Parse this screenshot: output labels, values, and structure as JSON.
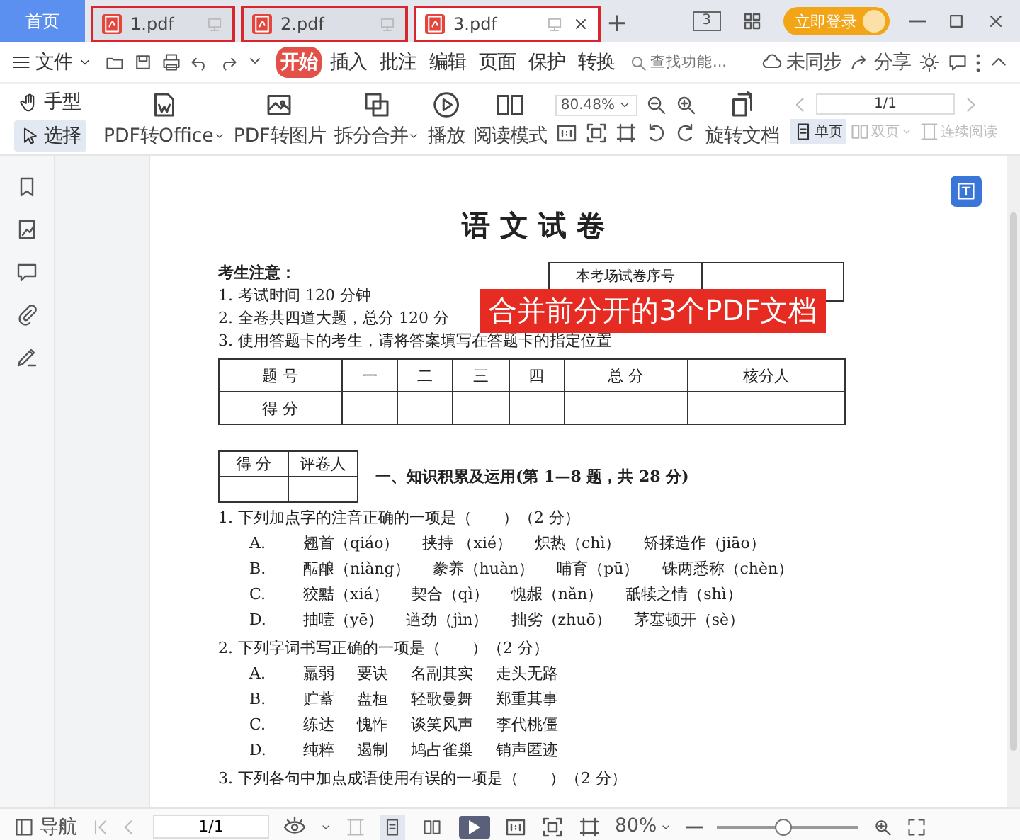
{
  "title_bar": {
    "home_tab": "首页",
    "tabs": [
      {
        "label": "1.pdf",
        "selected": false,
        "annotated": true
      },
      {
        "label": "2.pdf",
        "selected": false,
        "annotated": true
      },
      {
        "label": "3.pdf",
        "selected": true,
        "annotated": true
      }
    ],
    "new_tab": "+",
    "layout_badge": "3",
    "login": "立即登录"
  },
  "menu_bar": {
    "file": "文件",
    "tabs": [
      {
        "label": "开始",
        "selected": true
      },
      {
        "label": "插入",
        "selected": false
      },
      {
        "label": "批注",
        "selected": false
      },
      {
        "label": "编辑",
        "selected": false
      },
      {
        "label": "页面",
        "selected": false
      },
      {
        "label": "保护",
        "selected": false
      },
      {
        "label": "转换",
        "selected": false
      }
    ],
    "search": {
      "placeholder": "查找功能..."
    },
    "sync": "未同步",
    "share": "分享"
  },
  "toolbar": {
    "tools": [
      {
        "label": "手型",
        "kind": "hand",
        "selected": false
      },
      {
        "label": "选择",
        "kind": "select",
        "selected": true
      }
    ],
    "buttons": [
      {
        "label": "PDF转Office",
        "kind": "office",
        "has_menu": true
      },
      {
        "label": "PDF转图片",
        "kind": "image",
        "has_menu": false
      },
      {
        "label": "拆分合并",
        "kind": "split",
        "has_menu": true
      },
      {
        "label": "播放",
        "kind": "play",
        "has_menu": false
      },
      {
        "label": "阅读模式",
        "kind": "read",
        "has_menu": false
      }
    ],
    "zoom": "80.48%",
    "rotate": "旋转文档",
    "page": "1/1",
    "views": [
      {
        "label": "单页",
        "kind": "single",
        "selected": true,
        "disabled": false,
        "has_menu": false
      },
      {
        "label": "双页",
        "kind": "double",
        "selected": false,
        "disabled": true,
        "has_menu": true
      },
      {
        "label": "连续阅读",
        "kind": "continuous",
        "selected": false,
        "disabled": true,
        "has_menu": false
      }
    ]
  },
  "document": {
    "title": "语 文 试 卷",
    "notice_title": "考生注意：",
    "notices": [
      "1. 考试时间 120 分钟",
      "2. 全卷共四道大题，总分 120 分",
      "3. 使用答题卡的考生，请将答案填写在答题卡的指定位置"
    ],
    "seat_box": "本考场试卷序号",
    "score_table": {
      "columns": [
        "题 号",
        "一",
        "二",
        "三",
        "四",
        "总 分",
        "核分人"
      ],
      "row_label": "得 分"
    },
    "grader_table": {
      "columns": [
        "得 分",
        "评卷人"
      ]
    },
    "section": "一、知识积累及运用(第 1—8 题，共 28 分)",
    "questions": [
      {
        "text": "1. 下列加点字的注音正确的一项是（　　）（2 分）",
        "options": [
          {
            "letter": "A.",
            "words": [
              "翘首（qiáo）",
              "挟持 （xié）",
              "炽热（chì）",
              "矫揉造作（jiāo）"
            ]
          },
          {
            "letter": "B.",
            "words": [
              "酝酿（niàng）",
              "豢养（huàn）",
              "哺育（pū）",
              "铢两悉称（chèn）"
            ]
          },
          {
            "letter": "C.",
            "words": [
              "狡黠（xiá）",
              "契合（qì）",
              "愧赧（nǎn）",
              "舐犊之情（shì）"
            ]
          },
          {
            "letter": "D.",
            "words": [
              "抽噎（yē）",
              "遒劲（jìn）",
              "拙劣（zhuō）",
              "茅塞顿开（sè）"
            ]
          }
        ]
      },
      {
        "text": "2. 下列字词书写正确的一项是（　　）（2 分）",
        "options": [
          {
            "letter": "A.",
            "words": [
              "羸弱",
              "要诀",
              "名副其实",
              "走头无路"
            ]
          },
          {
            "letter": "B.",
            "words": [
              "贮蓄",
              "盘桓",
              "轻歌曼舞",
              "郑重其事"
            ]
          },
          {
            "letter": "C.",
            "words": [
              "练达",
              "愧怍",
              "谈笑风声",
              "李代桃僵"
            ]
          },
          {
            "letter": "D.",
            "words": [
              "纯粹",
              "遏制",
              "鸠占雀巢",
              "销声匿迹"
            ]
          }
        ]
      },
      {
        "text": "3. 下列各句中加点成语使用有误的一项是（　　）（2 分）"
      }
    ]
  },
  "overlay_label": "合并前分开的3个PDF文档",
  "status_bar": {
    "nav": "导航",
    "page": "1/1",
    "zoom": "80%",
    "level": 0.47,
    "views": [
      {
        "kind": "single",
        "selected": true
      },
      {
        "kind": "double",
        "selected": false
      }
    ]
  }
}
